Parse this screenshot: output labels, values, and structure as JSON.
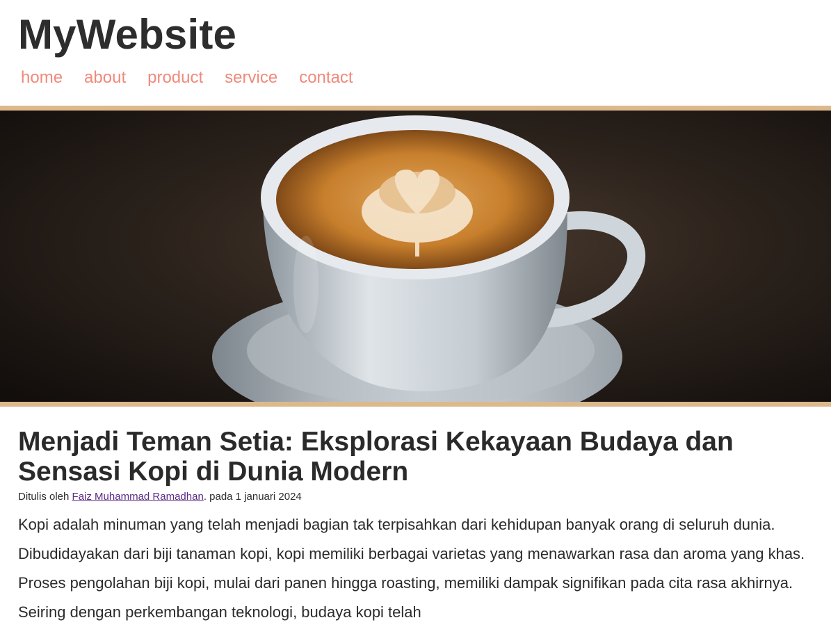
{
  "site": {
    "title": "MyWebsite"
  },
  "nav": {
    "items": [
      {
        "label": "home"
      },
      {
        "label": "about"
      },
      {
        "label": "product"
      },
      {
        "label": "service"
      },
      {
        "label": "contact"
      }
    ]
  },
  "hero": {
    "alt": "latte art coffee cup on saucer"
  },
  "article": {
    "title": "Menjadi Teman Setia: Eksplorasi Kekayaan Budaya dan Sensasi Kopi di Dunia Modern",
    "byline_prefix": "Ditulis oleh",
    "author": "Faiz Muhammad Ramadhan",
    "byline_suffix": ". pada 1 januari 2024",
    "body": "Kopi adalah minuman yang telah menjadi bagian tak terpisahkan dari kehidupan banyak orang di seluruh dunia. Dibudidayakan dari biji tanaman kopi, kopi memiliki berbagai varietas yang menawarkan rasa dan aroma yang khas. Proses pengolahan biji kopi, mulai dari panen hingga roasting, memiliki dampak signifikan pada cita rasa akhirnya. Seiring dengan perkembangan teknologi, budaya kopi telah"
  },
  "colors": {
    "nav_link": "#f08a7c",
    "hero_border": "#dcb98d",
    "author_link": "#5b2a86"
  }
}
